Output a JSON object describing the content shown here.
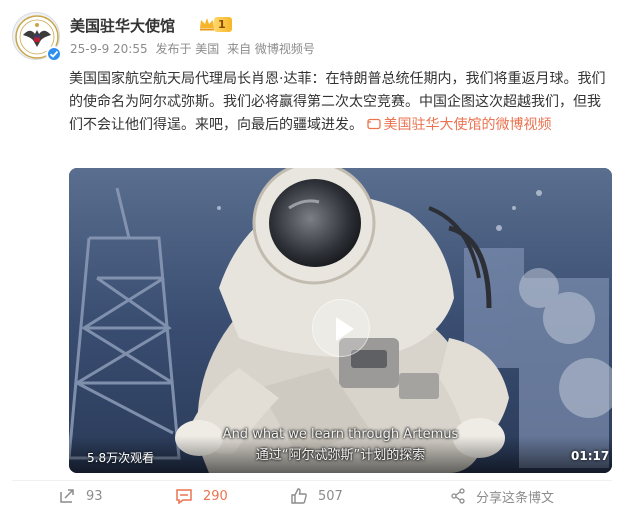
{
  "account": {
    "name": "美国驻华大使馆",
    "badge_level": "1",
    "timestamp": "25-9-9 20:55",
    "posted_from": "发布于 美国",
    "source": "来自 微博视频号"
  },
  "post": {
    "text": "美国国家航空航天局代理局长肖恩·达菲：在特朗普总统任期内，我们将重返月球。我们的使命名为阿尔忒弥斯。我们必将赢得第二次太空竞赛。中国企图这次超越我们，但我们不会让他们得逞。来吧，向最后的疆域进发。 ",
    "link_text": "美国驻华大使馆的微博视频"
  },
  "video": {
    "views": "5.8万次观看",
    "duration": "01:17",
    "subtitle_en": "And what we learn through Artemus",
    "subtitle_zh": "通过“阿尔忒弥斯”计划的探索"
  },
  "actions": {
    "repost_count": "93",
    "comment_count": "290",
    "like_count": "507",
    "share_label": "分享这条博文"
  },
  "colors": {
    "accent": "#eb7350",
    "verified": "#2f8ef0",
    "meta": "#8c8c8c"
  }
}
